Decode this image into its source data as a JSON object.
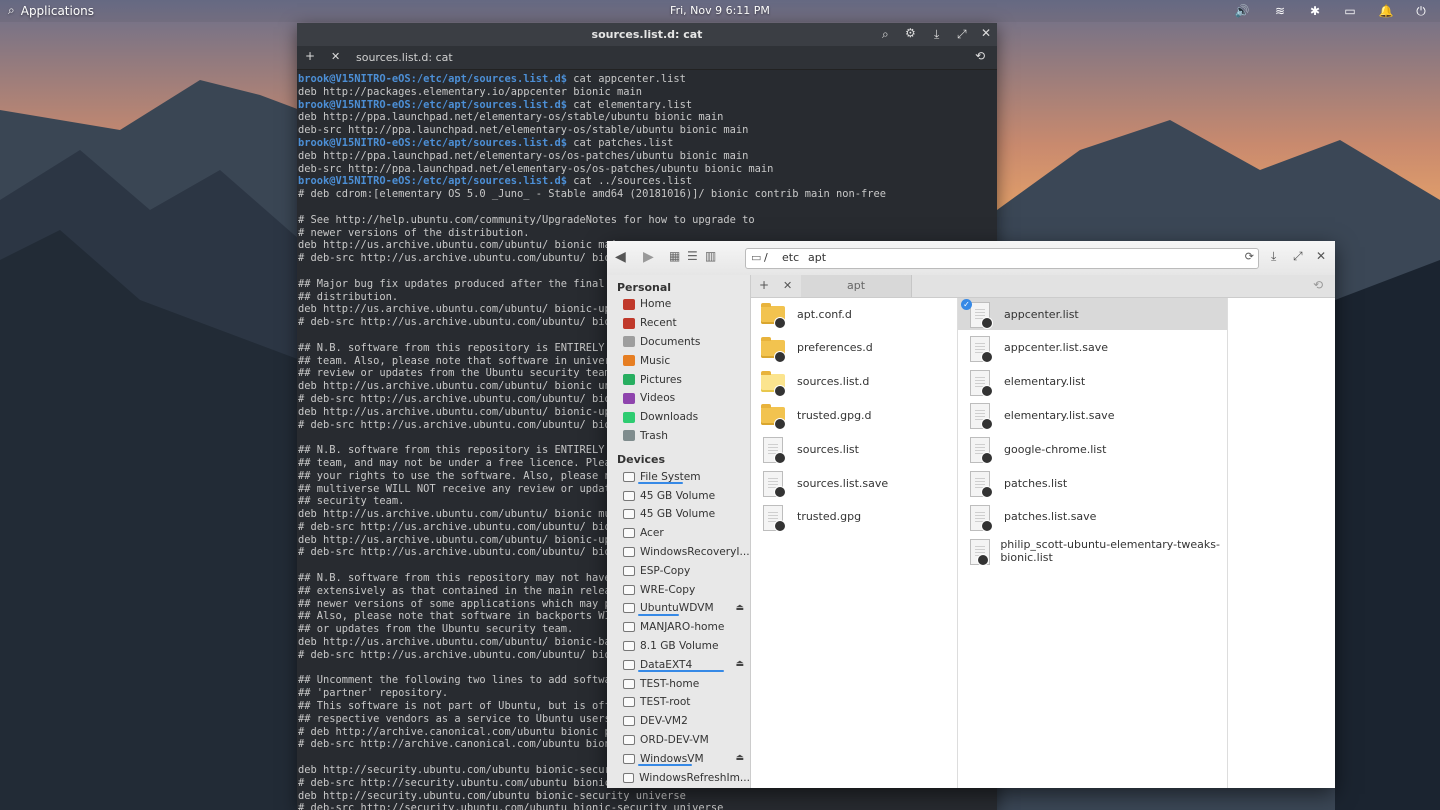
{
  "panel": {
    "applications": "Applications",
    "datetime": "Fri, Nov 9    6:11 PM"
  },
  "terminal": {
    "title": "sources.list.d: cat",
    "tab_label": "sources.list.d: cat",
    "prompt": "brook@V15NITRO-eOS:/etc/apt/sources.list.d$",
    "lines": [
      {
        "p": true,
        "t": " cat appcenter.list"
      },
      {
        "p": false,
        "t": "deb http://packages.elementary.io/appcenter bionic main"
      },
      {
        "p": true,
        "t": " cat elementary.list"
      },
      {
        "p": false,
        "t": "deb http://ppa.launchpad.net/elementary-os/stable/ubuntu bionic main"
      },
      {
        "p": false,
        "t": "deb-src http://ppa.launchpad.net/elementary-os/stable/ubuntu bionic main"
      },
      {
        "p": true,
        "t": " cat patches.list"
      },
      {
        "p": false,
        "t": "deb http://ppa.launchpad.net/elementary-os/os-patches/ubuntu bionic main"
      },
      {
        "p": false,
        "t": "deb-src http://ppa.launchpad.net/elementary-os/os-patches/ubuntu bionic main"
      },
      {
        "p": true,
        "t": " cat ../sources.list"
      },
      {
        "p": false,
        "t": "# deb cdrom:[elementary OS 5.0 _Juno_ - Stable amd64 (20181016)]/ bionic contrib main non-free"
      },
      {
        "p": false,
        "t": ""
      },
      {
        "p": false,
        "t": "# See http://help.ubuntu.com/community/UpgradeNotes for how to upgrade to"
      },
      {
        "p": false,
        "t": "# newer versions of the distribution."
      },
      {
        "p": false,
        "t": "deb http://us.archive.ubuntu.com/ubuntu/ bionic mai"
      },
      {
        "p": false,
        "t": "# deb-src http://us.archive.ubuntu.com/ubuntu/ bioni"
      },
      {
        "p": false,
        "t": ""
      },
      {
        "p": false,
        "t": "## Major bug fix updates produced after the final r"
      },
      {
        "p": false,
        "t": "## distribution."
      },
      {
        "p": false,
        "t": "deb http://us.archive.ubuntu.com/ubuntu/ bionic-upd"
      },
      {
        "p": false,
        "t": "# deb-src http://us.archive.ubuntu.com/ubuntu/ bioni"
      },
      {
        "p": false,
        "t": ""
      },
      {
        "p": false,
        "t": "## N.B. software from this repository is ENTIRELY U"
      },
      {
        "p": false,
        "t": "## team. Also, please note that software in universe"
      },
      {
        "p": false,
        "t": "## review or updates from the Ubuntu security team."
      },
      {
        "p": false,
        "t": "deb http://us.archive.ubuntu.com/ubuntu/ bionic univ"
      },
      {
        "p": false,
        "t": "# deb-src http://us.archive.ubuntu.com/ubuntu/ bioni"
      },
      {
        "p": false,
        "t": "deb http://us.archive.ubuntu.com/ubuntu/ bionic-upd"
      },
      {
        "p": false,
        "t": "# deb-src http://us.archive.ubuntu.com/ubuntu/ bioni"
      },
      {
        "p": false,
        "t": ""
      },
      {
        "p": false,
        "t": "## N.B. software from this repository is ENTIRELY U"
      },
      {
        "p": false,
        "t": "## team, and may not be under a free licence. Pleas"
      },
      {
        "p": false,
        "t": "## your rights to use the software. Also, please no"
      },
      {
        "p": false,
        "t": "## multiverse WILL NOT receive any review or update"
      },
      {
        "p": false,
        "t": "## security team."
      },
      {
        "p": false,
        "t": "deb http://us.archive.ubuntu.com/ubuntu/ bionic mul"
      },
      {
        "p": false,
        "t": "# deb-src http://us.archive.ubuntu.com/ubuntu/ bioni"
      },
      {
        "p": false,
        "t": "deb http://us.archive.ubuntu.com/ubuntu/ bionic-upd"
      },
      {
        "p": false,
        "t": "# deb-src http://us.archive.ubuntu.com/ubuntu/ bioni"
      },
      {
        "p": false,
        "t": ""
      },
      {
        "p": false,
        "t": "## N.B. software from this repository may not have b"
      },
      {
        "p": false,
        "t": "## extensively as that contained in the main releas"
      },
      {
        "p": false,
        "t": "## newer versions of some applications which may pr"
      },
      {
        "p": false,
        "t": "## Also, please note that software in backports WIL"
      },
      {
        "p": false,
        "t": "## or updates from the Ubuntu security team."
      },
      {
        "p": false,
        "t": "deb http://us.archive.ubuntu.com/ubuntu/ bionic-back"
      },
      {
        "p": false,
        "t": "# deb-src http://us.archive.ubuntu.com/ubuntu/ bioni"
      },
      {
        "p": false,
        "t": ""
      },
      {
        "p": false,
        "t": "## Uncomment the following two lines to add softwar"
      },
      {
        "p": false,
        "t": "## 'partner' repository."
      },
      {
        "p": false,
        "t": "## This software is not part of Ubuntu, but is offe"
      },
      {
        "p": false,
        "t": "## respective vendors as a service to Ubuntu users."
      },
      {
        "p": false,
        "t": "# deb http://archive.canonical.com/ubuntu bionic pa"
      },
      {
        "p": false,
        "t": "# deb-src http://archive.canonical.com/ubuntu bioni"
      },
      {
        "p": false,
        "t": ""
      },
      {
        "p": false,
        "t": "deb http://security.ubuntu.com/ubuntu bionic-securi"
      },
      {
        "p": false,
        "t": "# deb-src http://security.ubuntu.com/ubuntu bionic-"
      },
      {
        "p": false,
        "t": "deb http://security.ubuntu.com/ubuntu bionic-security universe"
      },
      {
        "p": false,
        "t": "# deb-src http://security.ubuntu.com/ubuntu bionic-security universe"
      }
    ]
  },
  "files": {
    "path": [
      "/",
      "etc",
      "apt"
    ],
    "tab_label": "apt",
    "sidebar": {
      "personal_header": "Personal",
      "personal": [
        {
          "label": "Home",
          "icon": "home-icon",
          "color": "#c0392b"
        },
        {
          "label": "Recent",
          "icon": "clock-icon",
          "color": "#c0392b"
        },
        {
          "label": "Documents",
          "icon": "documents-icon",
          "color": "#9e9e9e"
        },
        {
          "label": "Music",
          "icon": "music-icon",
          "color": "#e67e22"
        },
        {
          "label": "Pictures",
          "icon": "pictures-icon",
          "color": "#27ae60"
        },
        {
          "label": "Videos",
          "icon": "videos-icon",
          "color": "#8e44ad"
        },
        {
          "label": "Downloads",
          "icon": "downloads-icon",
          "color": "#2ecc71"
        },
        {
          "label": "Trash",
          "icon": "trash-icon",
          "color": "#7f8c8d"
        }
      ],
      "devices_header": "Devices",
      "devices": [
        {
          "label": "File System",
          "usage": 0.5,
          "eject": false
        },
        {
          "label": "45 GB Volume",
          "eject": false
        },
        {
          "label": "45 GB Volume",
          "eject": false
        },
        {
          "label": "Acer",
          "eject": false
        },
        {
          "label": "WindowsRecoveryI...",
          "eject": false
        },
        {
          "label": "ESP-Copy",
          "eject": false
        },
        {
          "label": "WRE-Copy",
          "eject": false
        },
        {
          "label": "UbuntuWDVM",
          "usage": 0.45,
          "eject": true
        },
        {
          "label": "MANJARO-home",
          "eject": false
        },
        {
          "label": "8.1 GB Volume",
          "eject": false
        },
        {
          "label": "DataEXT4",
          "usage": 0.95,
          "eject": true
        },
        {
          "label": "TEST-home",
          "eject": false
        },
        {
          "label": "TEST-root",
          "eject": false
        },
        {
          "label": "DEV-VM2",
          "eject": false
        },
        {
          "label": "ORD-DEV-VM",
          "eject": false
        },
        {
          "label": "WindowsVM",
          "usage": 0.6,
          "eject": true
        },
        {
          "label": "WindowsRefreshIm..."
        }
      ]
    },
    "column1": [
      {
        "name": "apt.conf.d",
        "kind": "folder"
      },
      {
        "name": "preferences.d",
        "kind": "folder"
      },
      {
        "name": "sources.list.d",
        "kind": "folder-light"
      },
      {
        "name": "trusted.gpg.d",
        "kind": "folder"
      },
      {
        "name": "sources.list",
        "kind": "file"
      },
      {
        "name": "sources.list.save",
        "kind": "file"
      },
      {
        "name": "trusted.gpg",
        "kind": "file"
      }
    ],
    "column2": [
      {
        "name": "appcenter.list",
        "selected": true
      },
      {
        "name": "appcenter.list.save"
      },
      {
        "name": "elementary.list"
      },
      {
        "name": "elementary.list.save"
      },
      {
        "name": "google-chrome.list"
      },
      {
        "name": "patches.list"
      },
      {
        "name": "patches.list.save"
      },
      {
        "name": "philip_scott-ubuntu-elementary-tweaks-bionic.list"
      }
    ]
  }
}
